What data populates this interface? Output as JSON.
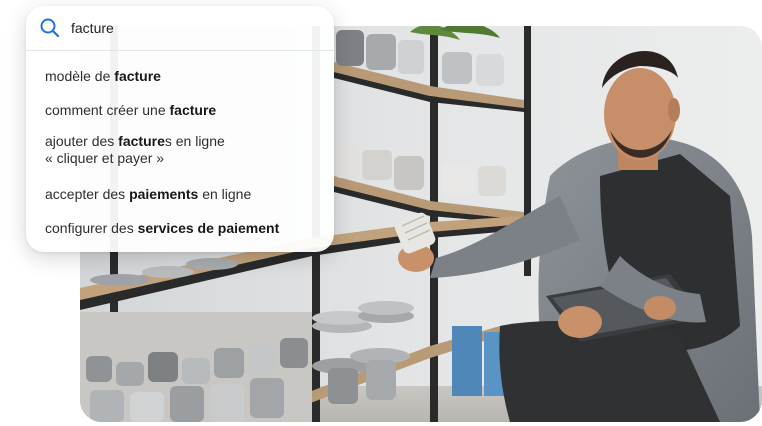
{
  "search": {
    "query": "facture"
  },
  "suggestions": [
    {
      "pre": "modèle de ",
      "bold": "facture",
      "post": "",
      "line2": ""
    },
    {
      "pre": "comment créer une ",
      "bold": "facture",
      "post": "",
      "line2": ""
    },
    {
      "pre": "ajouter des ",
      "bold": "facture",
      "post": "s en ligne",
      "line2": "« cliquer et payer »"
    },
    {
      "pre": "accepter des ",
      "bold": "paiements",
      "post": " en ligne",
      "line2": ""
    },
    {
      "pre": "configurer des ",
      "bold": "services de paiement",
      "post": "",
      "line2": ""
    }
  ],
  "colors": {
    "search_icon": "#1a73e8",
    "text": "#2b2f32"
  },
  "icons": {
    "search": "search-icon"
  }
}
